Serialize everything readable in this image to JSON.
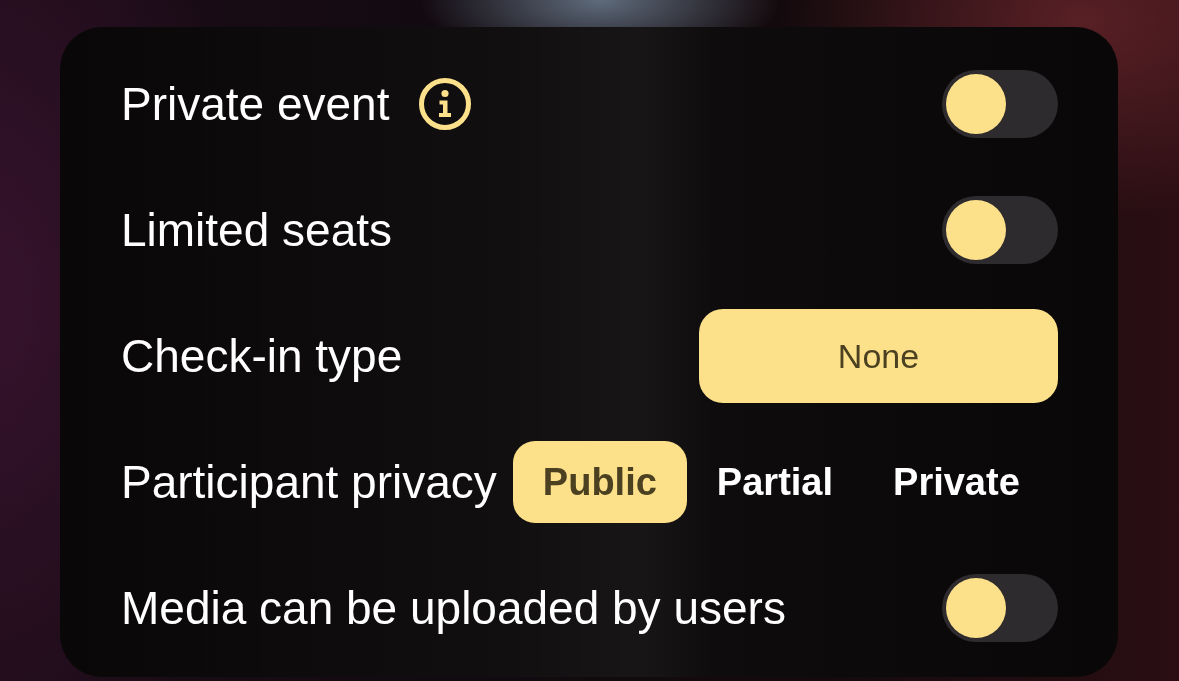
{
  "settings": [
    {
      "kind": "toggle",
      "label": "Private event",
      "info_icon": true,
      "on": false
    },
    {
      "kind": "toggle",
      "label": "Limited seats",
      "on": false
    },
    {
      "kind": "select",
      "label": "Check-in type",
      "value": "None"
    },
    {
      "kind": "segmented",
      "label": "Participant privacy",
      "options": [
        {
          "label": "Public",
          "selected": true
        },
        {
          "label": "Partial",
          "selected": false
        },
        {
          "label": "Private",
          "selected": false
        }
      ]
    },
    {
      "kind": "toggle",
      "label": "Media can be uploaded by users",
      "on": false
    }
  ]
}
